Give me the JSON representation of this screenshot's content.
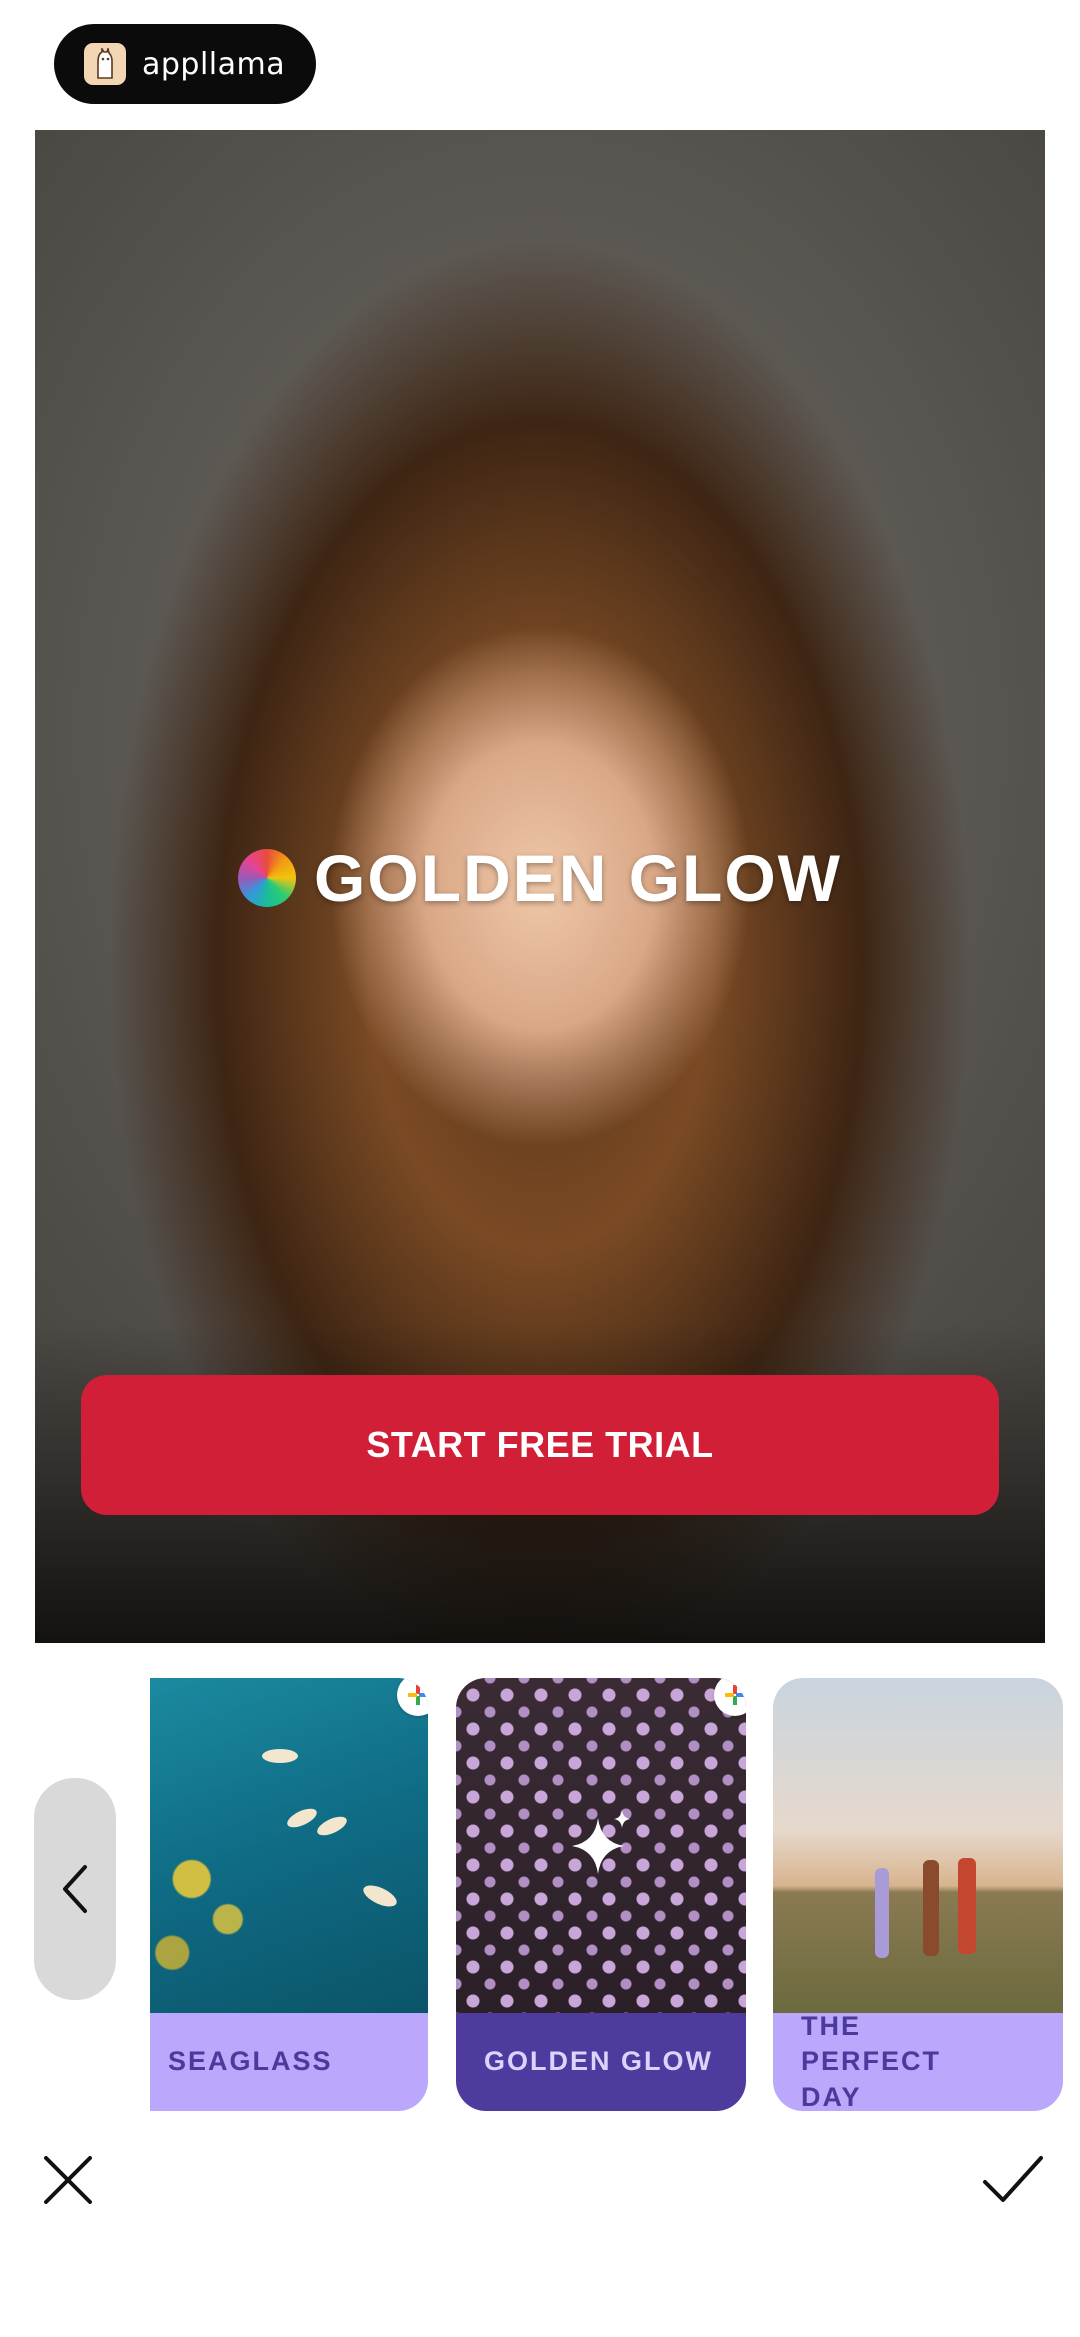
{
  "header": {
    "brand_name": "appllama"
  },
  "hero": {
    "filter_title": "GOLDEN GLOW",
    "cta_label": "START FREE TRIAL",
    "colors": {
      "cta": "#d01f36"
    }
  },
  "filters": [
    {
      "label": "SEAGLASS",
      "has_plus_badge": true,
      "selected": false
    },
    {
      "label": "GOLDEN GLOW",
      "has_plus_badge": true,
      "selected": true
    },
    {
      "label": "THE PERFECT DAY",
      "has_plus_badge": false,
      "selected": false
    }
  ],
  "icons": {
    "back": "chevron-left-icon",
    "close": "close-icon",
    "confirm": "checkmark-icon",
    "selected_filter": "sparkle-icon",
    "premium": "plus-icon"
  },
  "colors": {
    "label_purple": "#bba7fb",
    "selected_label_purple": "#4f3a9e"
  }
}
